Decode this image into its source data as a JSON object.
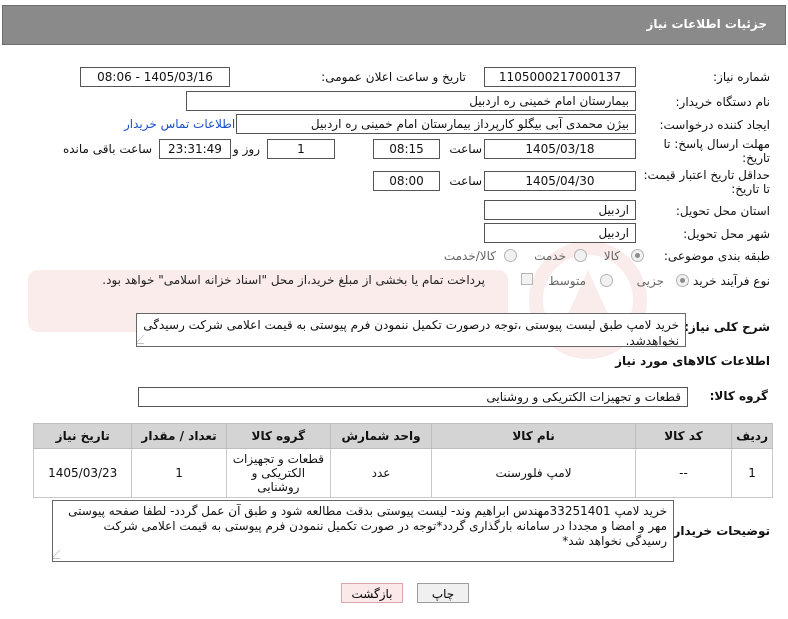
{
  "header": {
    "title": "جزئیات اطلاعات نیاز"
  },
  "form": {
    "need_number": {
      "label": "شماره نیاز:",
      "value": "1105000217000137"
    },
    "announce_datetime": {
      "label": "تاریخ و ساعت اعلان عمومی:",
      "value": "1405/03/16 - 08:06"
    },
    "buyer_org": {
      "label": "نام دستگاه خریدار:",
      "value": "بیمارستان امام خمینی  ره  اردبیل"
    },
    "requester": {
      "label": "ایجاد کننده درخواست:",
      "value": "بیژن محمدی آبی بیگلو کارپرداز بیمارستان امام خمینی  ره  اردبیل",
      "contact_link": "اطلاعات تماس خریدار"
    },
    "reply_deadline": {
      "label_line1": "مهلت ارسال پاسخ: تا",
      "label_line2": "تاریخ:",
      "date": "1405/03/18",
      "time_label": "ساعت",
      "time": "08:15",
      "days": "1",
      "days_label": "روز و",
      "remaining": "23:31:49",
      "remaining_label": "ساعت باقی مانده"
    },
    "price_validity": {
      "label_line1": "حداقل تاریخ اعتبار قیمت:",
      "label_line2": "تا تاریخ:",
      "date": "1405/04/30",
      "time_label": "ساعت",
      "time": "08:00"
    },
    "delivery_province": {
      "label": "استان محل تحویل:",
      "value": "اردبیل"
    },
    "delivery_city": {
      "label": "شهر محل تحویل:",
      "value": "اردبیل"
    },
    "category": {
      "label": "طبقه بندی موضوعی:",
      "options": [
        "کالا",
        "خدمت",
        "کالا/خدمت"
      ],
      "selected": "کالا"
    },
    "purchase_type": {
      "label": "نوع فرآیند خرید :",
      "options": [
        "جزیی",
        "متوسط"
      ],
      "selected": "جزیی",
      "payment_note": "پرداخت تمام یا بخشی از مبلغ خرید،از محل \"اسناد خزانه اسلامی\" خواهد بود."
    }
  },
  "description": {
    "label": "شرح کلی نیاز:",
    "value": "خرید لامپ طبق لیست پیوستی ،توجه درصورت تکمیل ننمودن فرم پیوستی به قیمت اعلامی شرکت رسیدگی نخواهدشد."
  },
  "goods_section": {
    "title": "اطلاعات کالاهای مورد نیاز",
    "group_label": "گروه کالا:",
    "group_value": "قطعات و تجهیزات الکتریکی و روشنایی"
  },
  "table": {
    "headers": [
      "ردیف",
      "کد کالا",
      "نام کالا",
      "واحد شمارش",
      "گروه کالا",
      "تعداد / مقدار",
      "تاریخ نیاز"
    ],
    "rows": [
      {
        "row": "1",
        "code": "--",
        "name": "لامپ فلورسنت",
        "unit": "عدد",
        "group": "قطعات و تجهیزات الکتریکی و روشنایی",
        "qty": "1",
        "date": "1405/03/23"
      }
    ]
  },
  "buyer_notes": {
    "label": "توضیحات خریدار:",
    "value": "خرید لامپ 33251401مهندس ابراهیم وند- لیست پیوستی بدقت مطالعه شود و طبق آن عمل گردد- لطفا صفحه پیوستی مهر و امضا و مجددا در سامانه بارگذاری گردد*توجه در صورت تکمیل ننمودن فرم پیوستی به قیمت اعلامی شرکت رسیدگی نخواهد شد*"
  },
  "buttons": {
    "print": "چاپ",
    "back": "بازگشت"
  }
}
